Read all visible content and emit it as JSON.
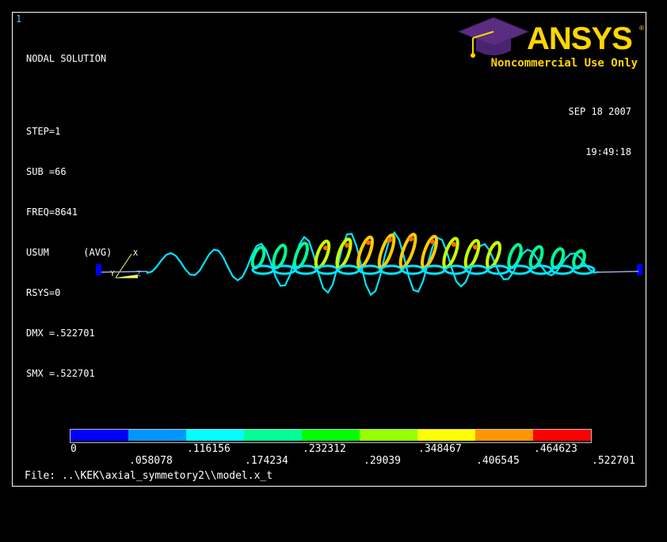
{
  "window_number": "1",
  "info": {
    "title": "NODAL SOLUTION",
    "step": "STEP=1",
    "sub": "SUB =66",
    "freq": "FREQ=8641",
    "usum": "USUM      (AVG)",
    "rsys": "RSYS=0",
    "dmx": "DMX =.522701",
    "smx": "SMX =.522701"
  },
  "date": "SEP 18 2007",
  "time": "19:49:18",
  "logo": {
    "text": "ANSYS",
    "tagline": "Noncommercial Use Only",
    "icon": "graduation-cap-icon"
  },
  "triad": {
    "x_label": "X",
    "y_label": "Y",
    "z_label": "Z"
  },
  "legend": {
    "colors": [
      "#0000ff",
      "#0096ff",
      "#00ffff",
      "#00ff96",
      "#00ff00",
      "#96ff00",
      "#ffff00",
      "#ff9600",
      "#ff0000"
    ],
    "ticks_top": [
      "0",
      ".116156",
      ".232312",
      ".348467",
      ".464623"
    ],
    "ticks_bottom": [
      ".058078",
      ".174234",
      ".29039",
      ".406545",
      ".522701"
    ]
  },
  "file_line": "File: ..\\KEK\\axial_symmetory2\\\\model.x_t"
}
